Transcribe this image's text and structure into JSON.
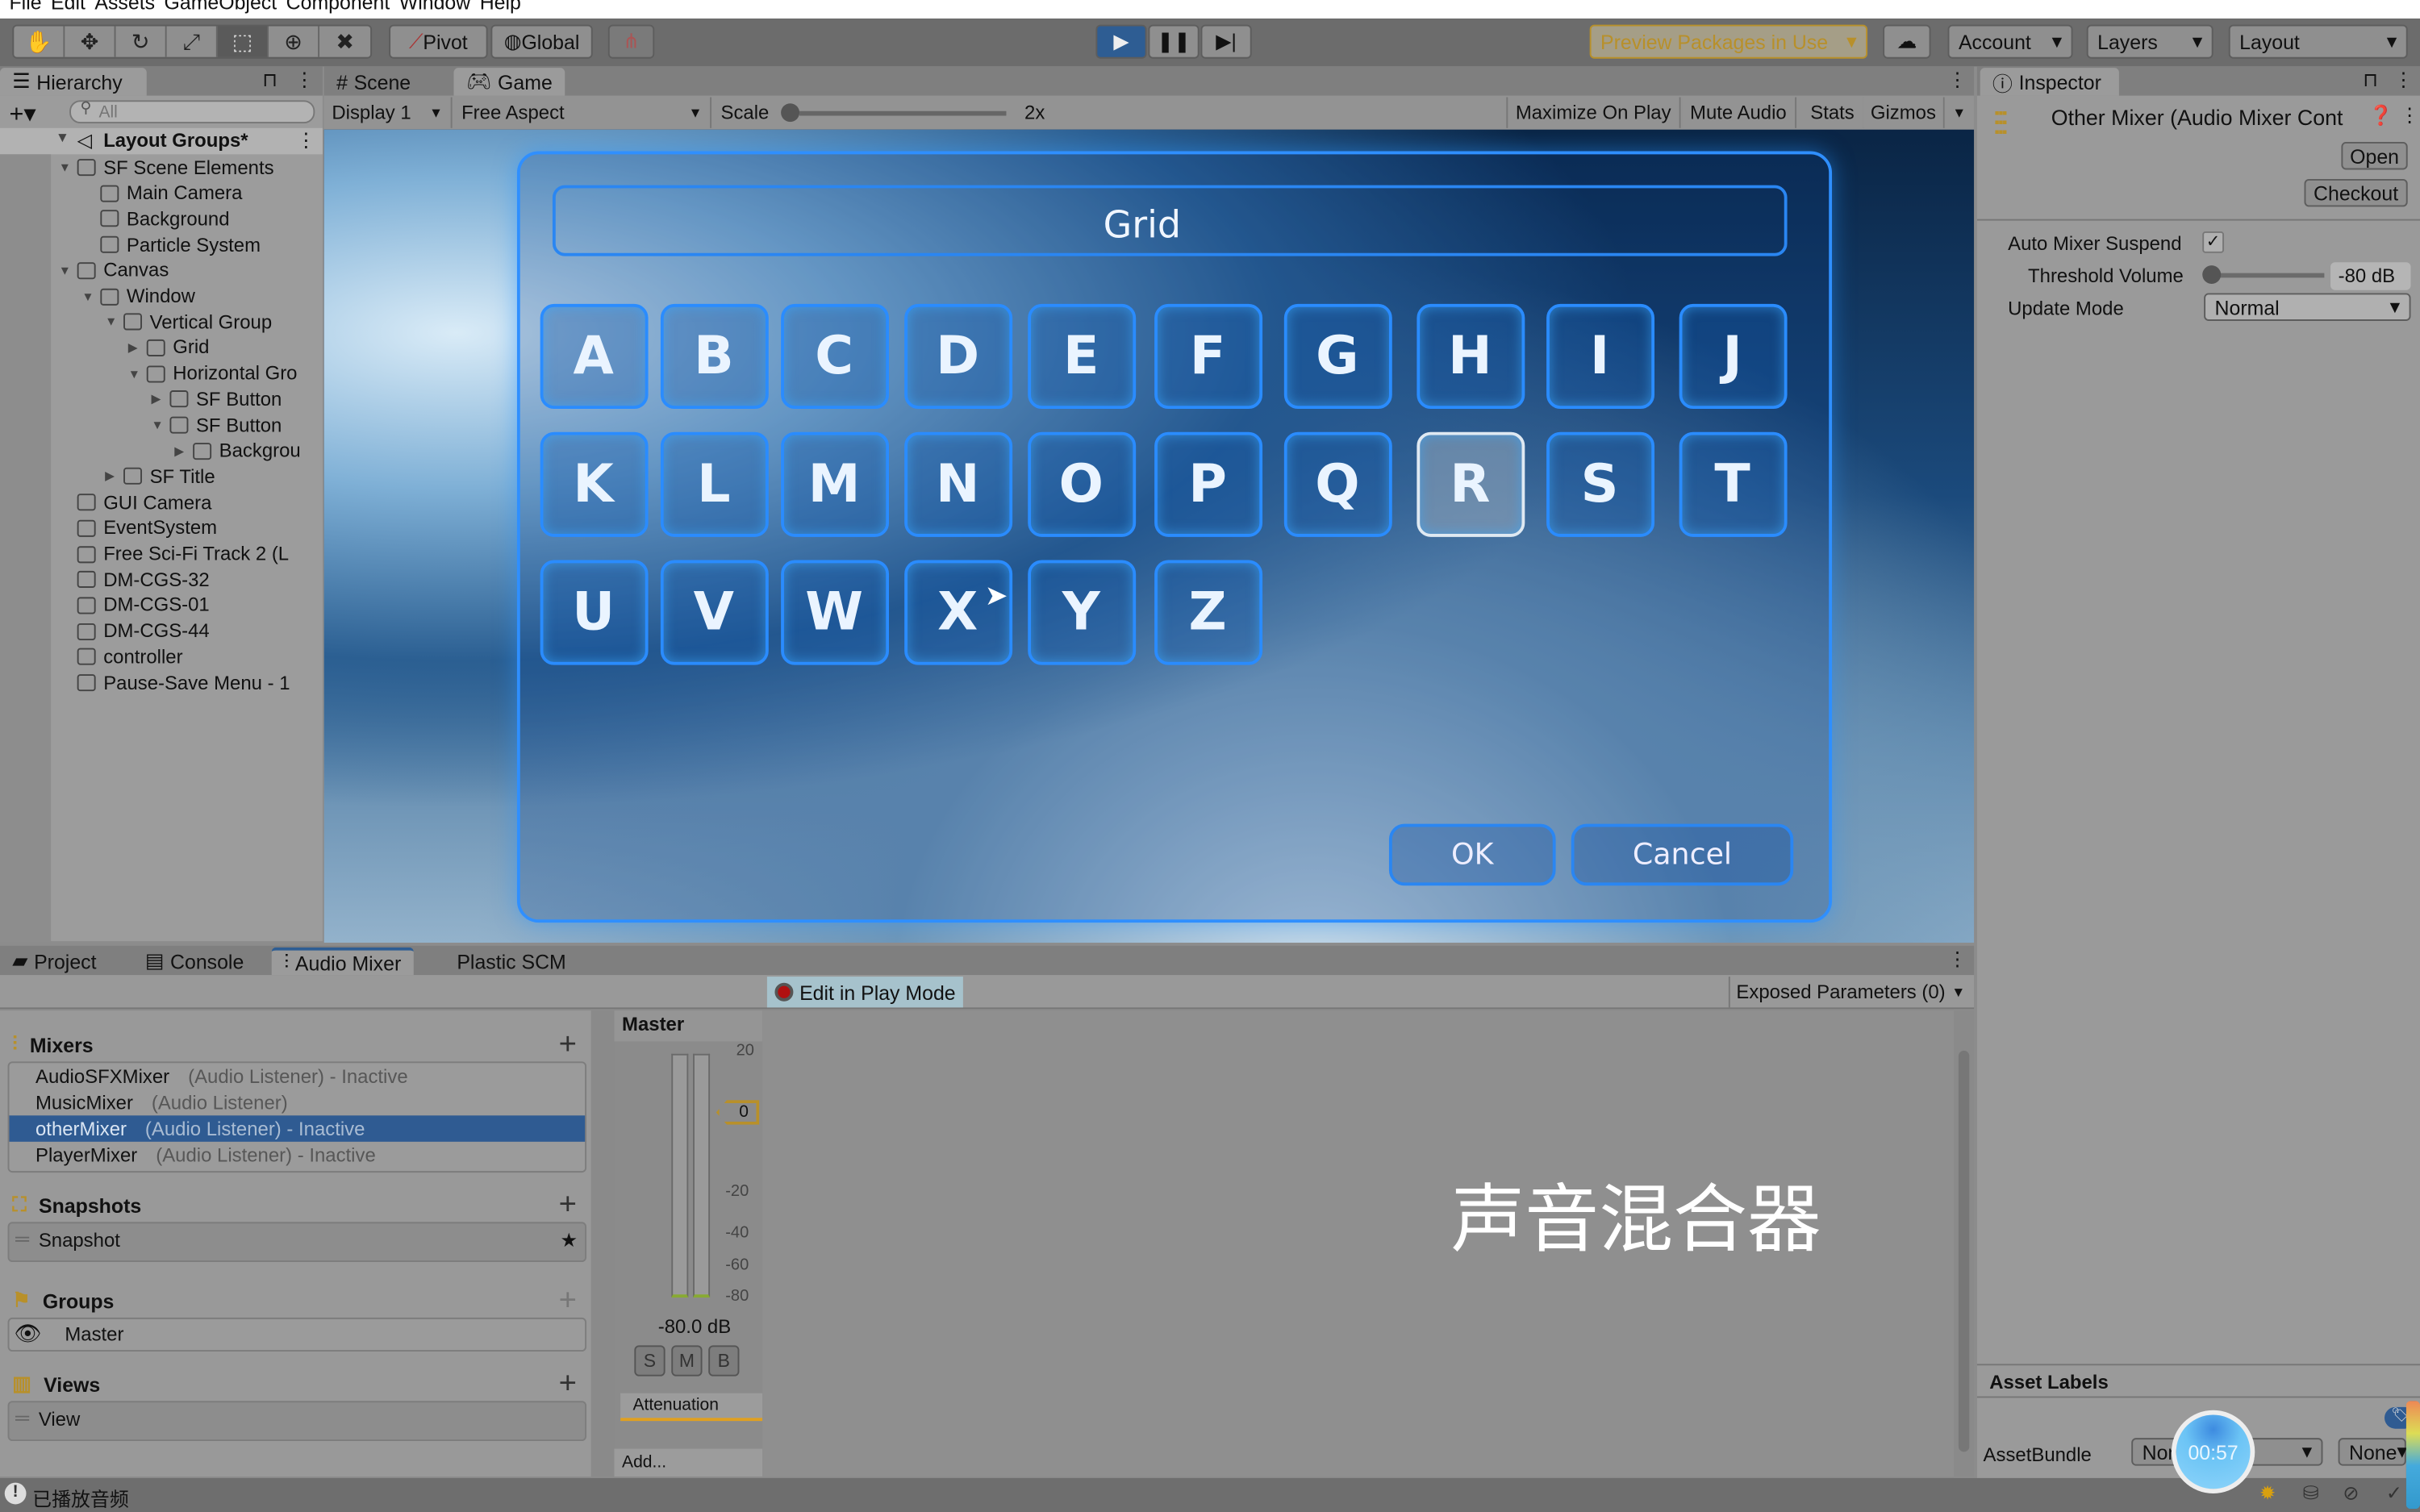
{
  "menu": [
    "File",
    "Edit",
    "Assets",
    "GameObject",
    "Component",
    "Window",
    "Help"
  ],
  "toolbar": {
    "tools": [
      "hand-icon",
      "move-icon",
      "rotate-icon",
      "scale-icon",
      "rect-icon",
      "transform-icon",
      "custom-tool-icon"
    ],
    "pivot": "Pivot",
    "global": "Global",
    "preview_packages": "Preview Packages in Use",
    "account": "Account",
    "layers": "Layers",
    "layout": "Layout",
    "accent": "#2e5d93",
    "preview_color": "#b8902a"
  },
  "hierarchy": {
    "tab": "Hierarchy",
    "search_placeholder": "All",
    "scene": "Layout Groups*",
    "items": [
      {
        "label": "SF Scene Elements",
        "depth": 1,
        "arrow": "open"
      },
      {
        "label": "Main Camera",
        "depth": 2,
        "arrow": ""
      },
      {
        "label": "Background",
        "depth": 2,
        "arrow": ""
      },
      {
        "label": "Particle System",
        "depth": 2,
        "arrow": ""
      },
      {
        "label": "Canvas",
        "depth": 1,
        "arrow": "open"
      },
      {
        "label": "Window",
        "depth": 2,
        "arrow": "open"
      },
      {
        "label": "Vertical Group",
        "depth": 3,
        "arrow": "open"
      },
      {
        "label": "Grid",
        "depth": 4,
        "arrow": "closed"
      },
      {
        "label": "Horizontal Gro",
        "depth": 4,
        "arrow": "open"
      },
      {
        "label": "SF Button",
        "depth": 5,
        "arrow": "closed"
      },
      {
        "label": "SF Button",
        "depth": 5,
        "arrow": "open"
      },
      {
        "label": "Backgrou",
        "depth": 6,
        "arrow": "closed"
      },
      {
        "label": "SF Title",
        "depth": 3,
        "arrow": "closed"
      },
      {
        "label": "GUI Camera",
        "depth": 1,
        "arrow": ""
      },
      {
        "label": "EventSystem",
        "depth": 1,
        "arrow": ""
      },
      {
        "label": "Free Sci-Fi Track 2 (L",
        "depth": 1,
        "arrow": ""
      },
      {
        "label": "DM-CGS-32",
        "depth": 1,
        "arrow": ""
      },
      {
        "label": "DM-CGS-01",
        "depth": 1,
        "arrow": ""
      },
      {
        "label": "DM-CGS-44",
        "depth": 1,
        "arrow": ""
      },
      {
        "label": "controller",
        "depth": 1,
        "arrow": ""
      },
      {
        "label": "Pause-Save Menu - 1",
        "depth": 1,
        "arrow": ""
      }
    ]
  },
  "game": {
    "tabs": [
      "Scene",
      "Game"
    ],
    "display": "Display 1",
    "aspect": "Free Aspect",
    "scale_label": "Scale",
    "scale_value": "2x",
    "maximize": "Maximize On Play",
    "mute": "Mute Audio",
    "stats": "Stats",
    "gizmos": "Gizmos",
    "title": "Grid",
    "letters": [
      "A",
      "B",
      "C",
      "D",
      "E",
      "F",
      "G",
      "H",
      "I",
      "J",
      "K",
      "L",
      "M",
      "N",
      "O",
      "P",
      "Q",
      "R",
      "S",
      "T",
      "U",
      "V",
      "W",
      "X",
      "Y",
      "Z"
    ],
    "selected_letter": "R",
    "ok": "OK",
    "cancel": "Cancel"
  },
  "inspector": {
    "tab": "Inspector",
    "title": "Other Mixer (Audio Mixer Cont",
    "open": "Open",
    "checkout": "Checkout",
    "auto_suspend_label": "Auto Mixer Suspend",
    "auto_suspend_checked": true,
    "threshold_label": "Threshold Volume",
    "threshold_value": "-80 dB",
    "threshold_fraction": 0,
    "update_mode_label": "Update Mode",
    "update_mode_value": "Normal",
    "asset_labels": "Asset Labels",
    "assetbundle_label": "AssetBundle",
    "assetbundle_value": "None",
    "assetbundle_variant": "None"
  },
  "bottom": {
    "tabs": [
      "Project",
      "Console",
      "Audio Mixer",
      "Plastic SCM"
    ],
    "edit_play_mode": "Edit in Play Mode",
    "exposed": "Exposed Parameters (0)",
    "mixers_header": "Mixers",
    "mixers": [
      {
        "name": "AudioSFXMixer",
        "sub": "(Audio Listener) - Inactive",
        "selected": false
      },
      {
        "name": "MusicMixer",
        "sub": "(Audio Listener)",
        "selected": false
      },
      {
        "name": "otherMixer",
        "sub": "(Audio Listener) - Inactive",
        "selected": true
      },
      {
        "name": "PlayerMixer",
        "sub": "(Audio Listener) - Inactive",
        "selected": false
      }
    ],
    "snapshots_header": "Snapshots",
    "snapshot": "Snapshot",
    "groups_header": "Groups",
    "group": "Master",
    "views_header": "Views",
    "view": "View",
    "strip": {
      "name": "Master",
      "scale": [
        "20",
        "0",
        "-20",
        "-40",
        "-60",
        "-80"
      ],
      "fader": "0",
      "level": "-80.0 dB",
      "s": "S",
      "m": "M",
      "b": "B",
      "effect": "Attenuation",
      "add": "Add..."
    },
    "overlay_text": "声音混合器"
  },
  "status": {
    "message": "已播放音频",
    "timer": "00:57"
  }
}
